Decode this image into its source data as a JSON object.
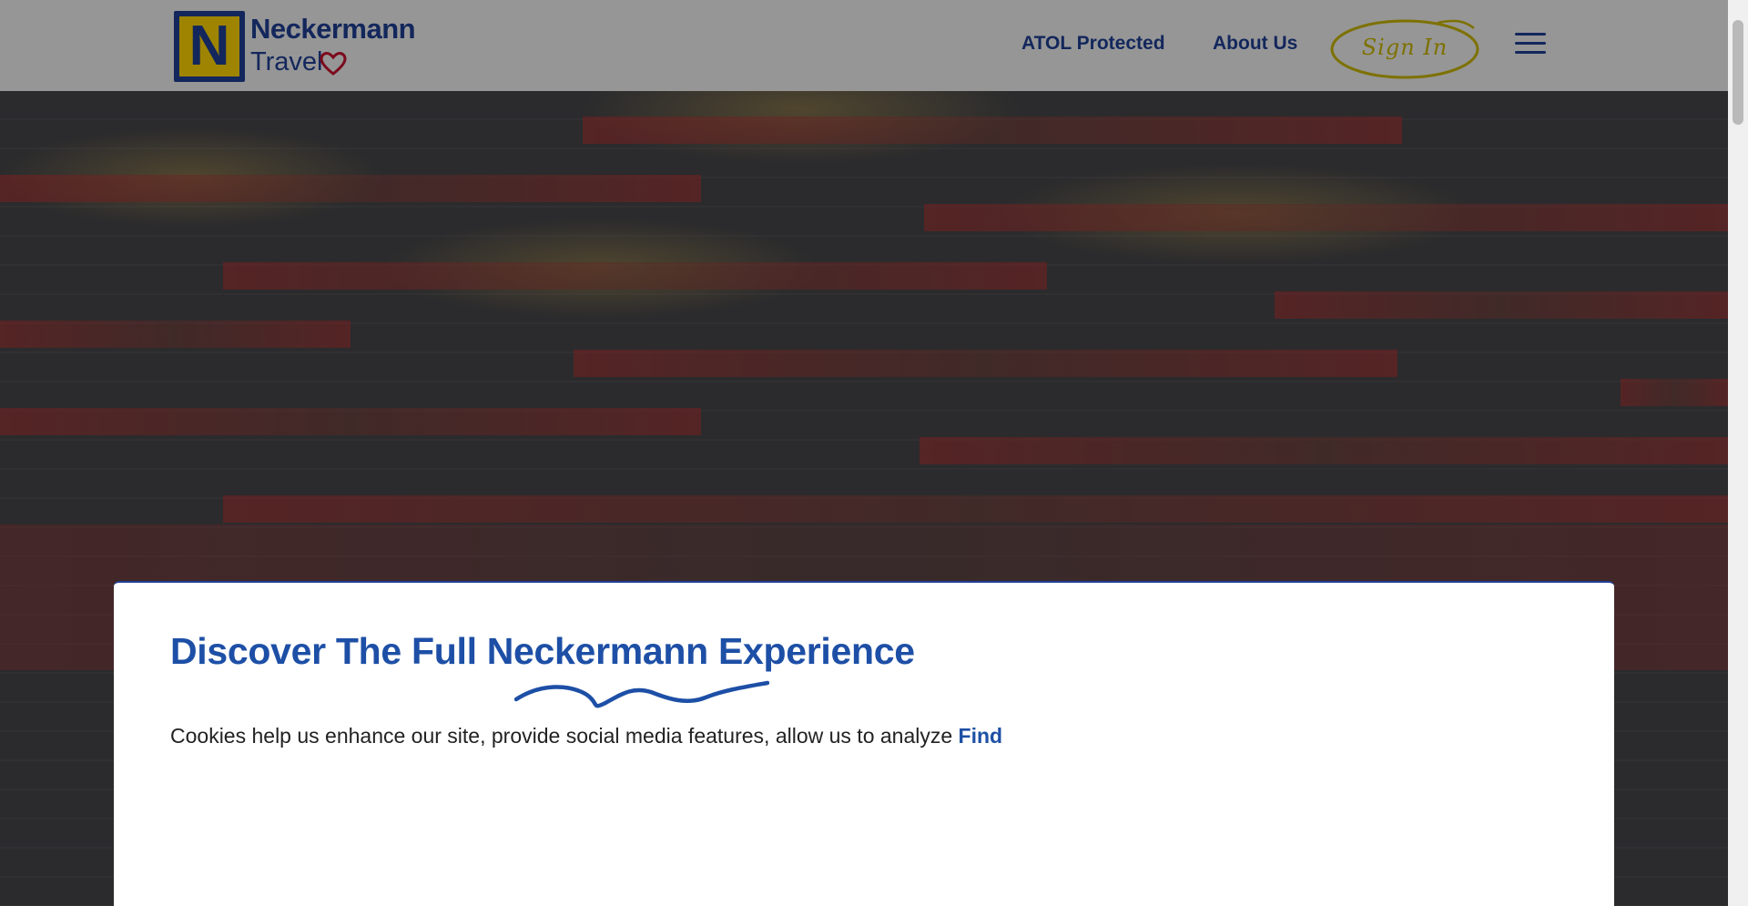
{
  "header": {
    "logo_letter": "N",
    "logo_name": "Neckermann",
    "logo_sub": "Travel",
    "nav": {
      "atol_label": "ATOL Protected",
      "about_label": "About Us",
      "signin_label": "Sign In"
    }
  },
  "cookie_dialog": {
    "title": "Discover The Full Neckermann Experience",
    "body": "Cookies help us enhance our site, provide social media features, allow us to analyze",
    "link_label": "Find"
  },
  "colors": {
    "brand_blue": "#1f3f95",
    "brand_yellow": "#ffd500",
    "heart_red": "#c8102e",
    "signin_outline": "#c9b700",
    "dialog_title": "#1d4fa6"
  },
  "icons": [
    "heart-icon",
    "menu-icon"
  ]
}
